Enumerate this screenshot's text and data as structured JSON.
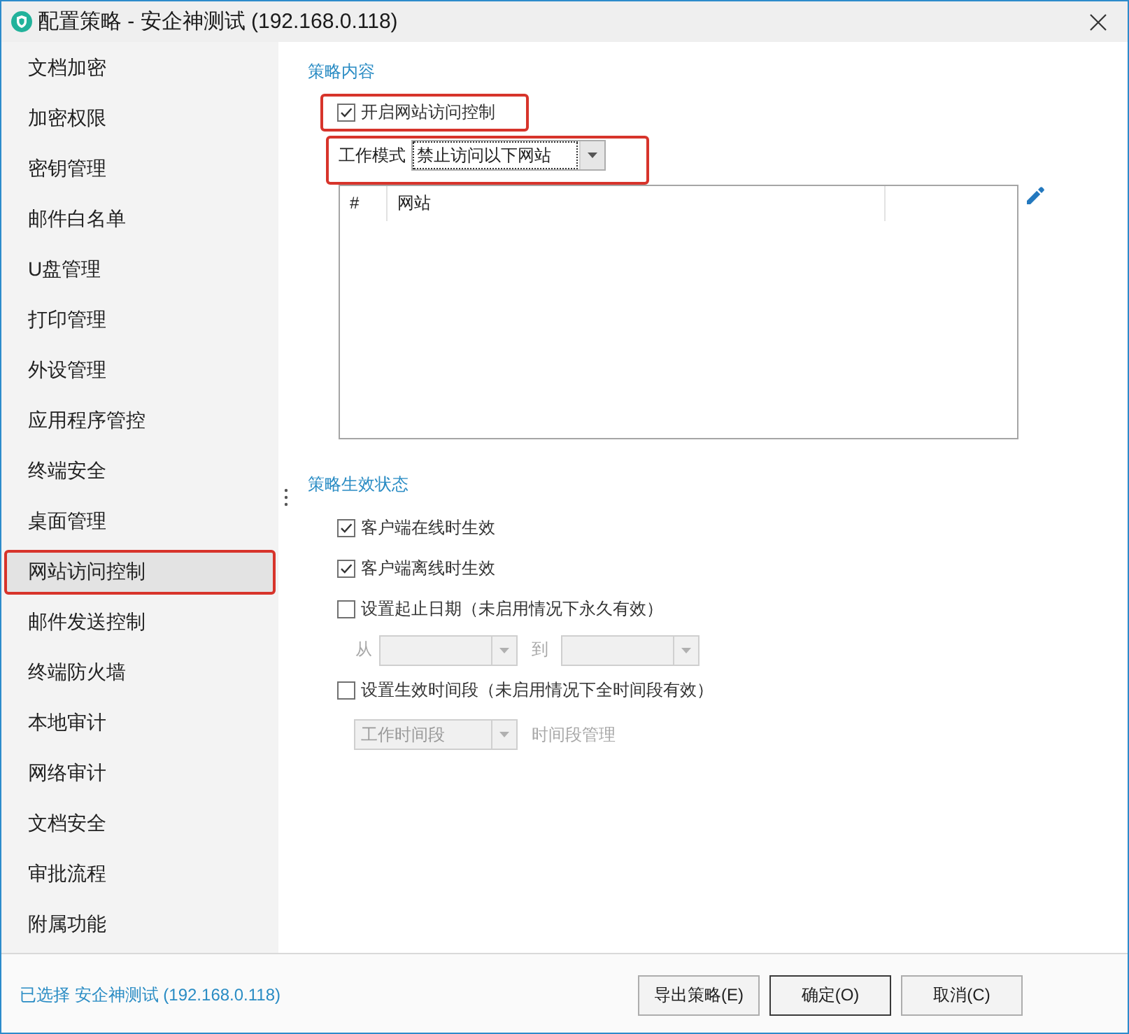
{
  "window": {
    "title": "配置策略 - 安企神测试 (192.168.0.118)"
  },
  "sidebar": {
    "items": [
      {
        "label": "文档加密",
        "selected": false,
        "highlighted": false
      },
      {
        "label": "加密权限",
        "selected": false,
        "highlighted": false
      },
      {
        "label": "密钥管理",
        "selected": false,
        "highlighted": false
      },
      {
        "label": "邮件白名单",
        "selected": false,
        "highlighted": false
      },
      {
        "label": "U盘管理",
        "selected": false,
        "highlighted": false
      },
      {
        "label": "打印管理",
        "selected": false,
        "highlighted": false
      },
      {
        "label": "外设管理",
        "selected": false,
        "highlighted": false
      },
      {
        "label": "应用程序管控",
        "selected": false,
        "highlighted": false
      },
      {
        "label": "终端安全",
        "selected": false,
        "highlighted": false
      },
      {
        "label": "桌面管理",
        "selected": false,
        "highlighted": false
      },
      {
        "label": "网站访问控制",
        "selected": true,
        "highlighted": true
      },
      {
        "label": "邮件发送控制",
        "selected": false,
        "highlighted": false
      },
      {
        "label": "终端防火墙",
        "selected": false,
        "highlighted": false
      },
      {
        "label": "本地审计",
        "selected": false,
        "highlighted": false
      },
      {
        "label": "网络审计",
        "selected": false,
        "highlighted": false
      },
      {
        "label": "文档安全",
        "selected": false,
        "highlighted": false
      },
      {
        "label": "审批流程",
        "selected": false,
        "highlighted": false
      },
      {
        "label": "附属功能",
        "selected": false,
        "highlighted": false
      }
    ]
  },
  "policy_content": {
    "heading": "策略内容",
    "enable": {
      "label": "开启网站访问控制",
      "checked": true,
      "highlighted": true
    },
    "mode": {
      "label": "工作模式",
      "value": "禁止访问以下网站",
      "focused": true,
      "highlighted": true
    },
    "table": {
      "columns": [
        {
          "label": "#"
        },
        {
          "label": "网站"
        }
      ]
    }
  },
  "policy_status": {
    "heading": "策略生效状态",
    "options": [
      {
        "kind": "checkbox",
        "label": "客户端在线时生效",
        "checked": true
      },
      {
        "kind": "checkbox",
        "label": "客户端离线时生效",
        "checked": true
      },
      {
        "kind": "checkbox",
        "label": "设置起止日期（未启用情况下永久有效）",
        "checked": false
      },
      {
        "kind": "date_range",
        "from_label": "从",
        "to_label": "到",
        "disabled": true
      },
      {
        "kind": "checkbox",
        "label": "设置生效时间段（未启用情况下全时间段有效）",
        "checked": false
      },
      {
        "kind": "period",
        "value": "工作时间段",
        "link": "时间段管理",
        "disabled": true
      }
    ]
  },
  "footer": {
    "selection": "已选择 安企神测试 (192.168.0.118)",
    "buttons": [
      {
        "label": "导出策略(E)",
        "default": false
      },
      {
        "label": "确定(O)",
        "default": true
      },
      {
        "label": "取消(C)",
        "default": false
      }
    ]
  }
}
